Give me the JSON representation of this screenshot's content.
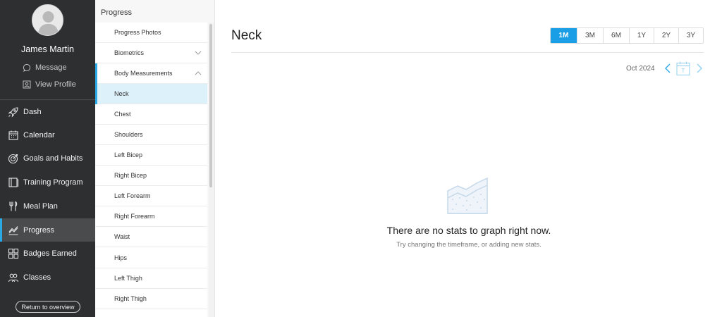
{
  "user": {
    "name": "James Martin",
    "message_label": "Message",
    "view_profile_label": "View Profile"
  },
  "nav": [
    {
      "label": "Dash",
      "icon": "rocket-icon"
    },
    {
      "label": "Calendar",
      "icon": "calendar-icon"
    },
    {
      "label": "Goals and Habits",
      "icon": "target-icon"
    },
    {
      "label": "Training Program",
      "icon": "book-icon"
    },
    {
      "label": "Meal Plan",
      "icon": "utensils-icon"
    },
    {
      "label": "Progress",
      "icon": "chart-icon",
      "active": true
    },
    {
      "label": "Badges Earned",
      "icon": "badges-icon"
    },
    {
      "label": "Classes",
      "icon": "people-icon"
    }
  ],
  "return_label": "Return to overview",
  "subpanel": {
    "title": "Progress",
    "items": [
      {
        "label": "Progress Photos"
      },
      {
        "label": "Biometrics",
        "chevron": "down"
      },
      {
        "label": "Body Measurements",
        "chevron": "up",
        "group": true
      },
      {
        "label": "Neck",
        "active": true
      },
      {
        "label": "Chest"
      },
      {
        "label": "Shoulders"
      },
      {
        "label": "Left Bicep"
      },
      {
        "label": "Right Bicep"
      },
      {
        "label": "Left Forearm"
      },
      {
        "label": "Right Forearm"
      },
      {
        "label": "Waist"
      },
      {
        "label": "Hips"
      },
      {
        "label": "Left Thigh"
      },
      {
        "label": "Right Thigh"
      }
    ]
  },
  "main": {
    "title": "Neck",
    "ranges": [
      "1M",
      "3M",
      "6M",
      "1Y",
      "2Y",
      "3Y"
    ],
    "active_range": "1M",
    "date_label": "Oct 2024",
    "calendar_glyph": "T",
    "empty_title": "There are no stats to graph right now.",
    "empty_subtitle": "Try changing the timeframe, or adding new stats."
  },
  "colors": {
    "accent": "#1a9fe6",
    "sidebar_bg": "#2e2f31",
    "sidebar_active": "#4a4b4d",
    "selected_row": "#ddf1fb"
  }
}
